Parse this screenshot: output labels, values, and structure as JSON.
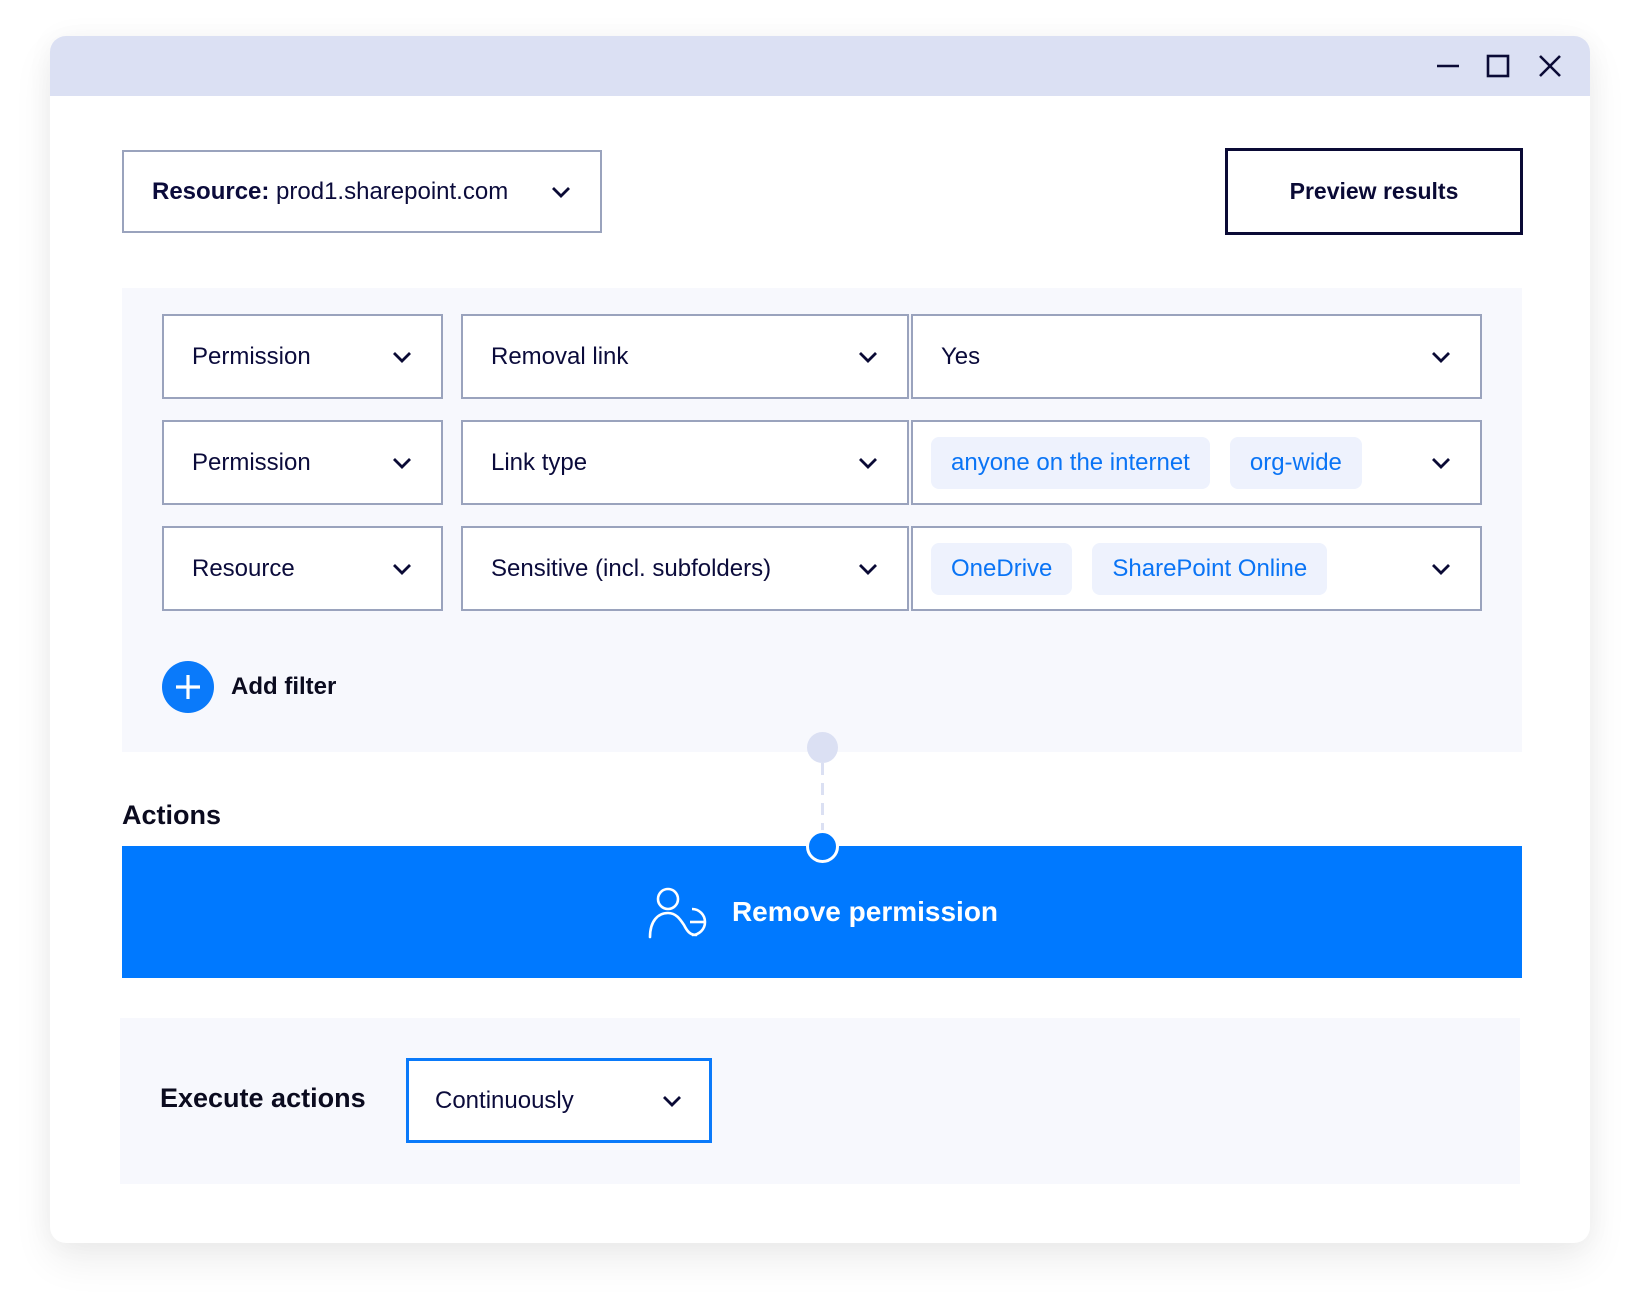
{
  "window": {
    "controls": {
      "minimize_icon": "minimize-icon",
      "maximize_icon": "maximize-icon",
      "close_icon": "close-icon"
    }
  },
  "header": {
    "resource_selector": {
      "label": "Resource:",
      "value": "prod1.sharepoint.com"
    },
    "preview_button": "Preview results"
  },
  "filters": {
    "rows": [
      {
        "field": "Permission",
        "attribute": "Removal link",
        "values": [
          "Yes"
        ],
        "value_type": "text"
      },
      {
        "field": "Permission",
        "attribute": "Link type",
        "values": [
          "anyone on the internet",
          "org-wide"
        ],
        "value_type": "chips"
      },
      {
        "field": "Resource",
        "attribute": "Sensitive (incl. subfolders)",
        "values": [
          "OneDrive",
          "SharePoint Online"
        ],
        "value_type": "chips"
      }
    ],
    "add_filter_label": "Add filter"
  },
  "actions": {
    "heading": "Actions",
    "items": [
      {
        "label": "Remove permission",
        "icon": "user-remove-icon"
      }
    ]
  },
  "execution": {
    "label": "Execute actions",
    "selected": "Continuously"
  },
  "colors": {
    "accent": "#0079ff",
    "title_bar": "#dbe0f3",
    "panel_bg": "#f7f8fd",
    "chip_bg": "#eef2fd",
    "chip_text": "#0a74f5",
    "border": "#9aa3bd",
    "text_dark": "#0b0b3b"
  }
}
